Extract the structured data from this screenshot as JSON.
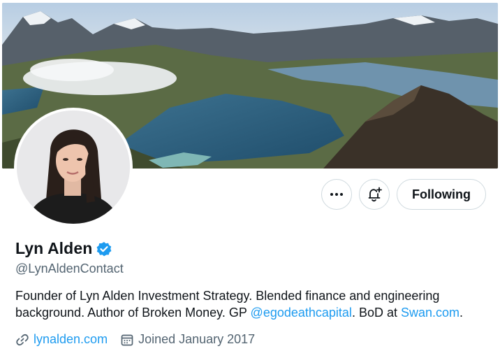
{
  "profile": {
    "name": "Lyn Alden",
    "handle": "@LynAldenContact",
    "verified": true,
    "bio": {
      "part1": "Founder of Lyn Alden Investment Strategy. Blended finance and engineering background. Author of Broken Money. GP ",
      "mention": "@egodeathcapital",
      "part2": ". BoD at ",
      "site_link": "Swan.com",
      "part3": "."
    },
    "website": "lynalden.com",
    "joined": "Joined January 2017"
  },
  "actions": {
    "more_icon": "more-horizontal-icon",
    "notify_icon": "bell-plus-icon",
    "follow_label": "Following"
  },
  "colors": {
    "link": "#1d9bf0",
    "muted": "#536471",
    "text": "#0f1419",
    "border": "#cfd9de"
  }
}
